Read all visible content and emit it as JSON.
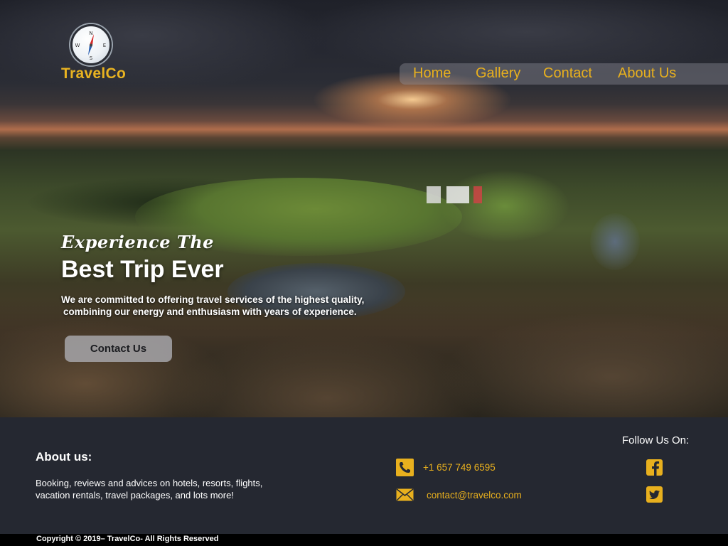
{
  "brand": {
    "name": "TravelCo"
  },
  "nav": {
    "items": [
      "Home",
      "Gallery",
      "Contact",
      "About Us"
    ]
  },
  "hero": {
    "tagline": "Experience The",
    "headline": "Best Trip Ever",
    "lead_line1": "We are committed to offering travel services of the highest quality,",
    "lead_line2": "combining our energy and enthusiasm with years of experience.",
    "cta_label": "Contact Us"
  },
  "footer": {
    "about_title": "About us:",
    "about_line1": "Booking, reviews and advices on hotels, resorts, flights,",
    "about_line2": "vacation rentals, travel packages, and lots more!",
    "phone": "+1 657 749 6595",
    "email": "contact@travelco.com",
    "follow_label": "Follow Us On:",
    "social": [
      "facebook-icon",
      "twitter-icon"
    ],
    "copyright": "Copyright © 2019– TravelCo- All Rights Reserved"
  },
  "colors": {
    "accent": "#e8b01e",
    "footer_bg": "#252831",
    "copyright_bg": "#000000"
  }
}
